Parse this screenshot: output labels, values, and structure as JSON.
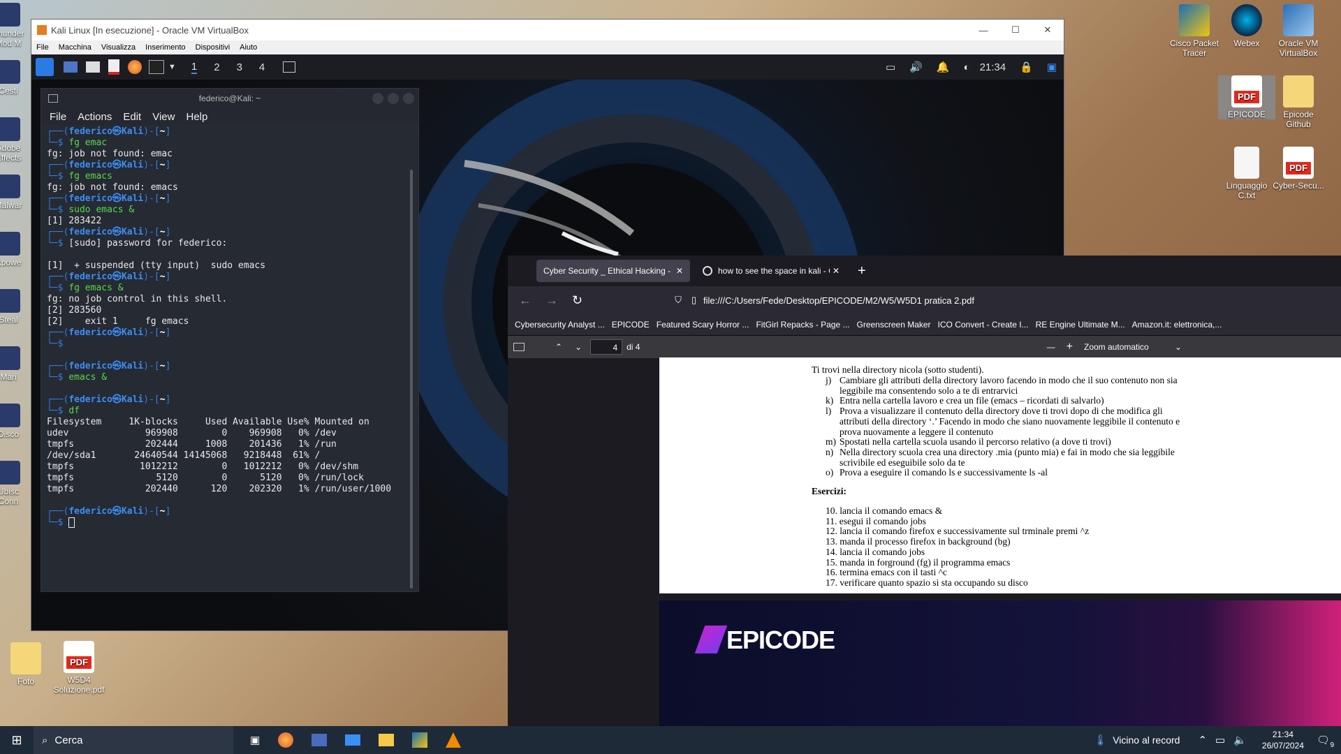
{
  "desktop": {
    "icons_left": [
      "Thunder Mod M",
      "Cesti",
      "Adobe Effects",
      "Malwar",
      "Apowe",
      "Steal",
      "Mari",
      "Disco",
      "Ubisc Conn"
    ],
    "icons_right": [
      {
        "label": "Cisco Packet Tracer"
      },
      {
        "label": "Webex"
      },
      {
        "label": "Oracle VM VirtualBox"
      },
      {
        "label": "EPICODE"
      },
      {
        "label": "Epicode Github"
      },
      {
        "label": "Linguaggio C.txt"
      },
      {
        "label": "Cyber-Secu..."
      }
    ],
    "icons_bottom": [
      {
        "label": "Foto"
      },
      {
        "label": "W5D4 Soluzione.pdf"
      }
    ]
  },
  "vbox": {
    "title": "Kali Linux [In esecuzione] - Oracle VM VirtualBox",
    "menu": [
      "File",
      "Macchina",
      "Visualizza",
      "Inserimento",
      "Dispositivi",
      "Aiuto"
    ],
    "workspaces": [
      "1",
      "2",
      "3",
      "4"
    ],
    "clock": "21:34"
  },
  "terminal": {
    "title": "federico@Kali: ~",
    "menu": [
      "File",
      "Actions",
      "Edit",
      "View",
      "Help"
    ],
    "user": "federico",
    "host": "Kali",
    "cwd": "~",
    "prompt_at": "㉿",
    "blocks": [
      {
        "cmd": "fg emac",
        "out": [
          "fg: job not found: emac"
        ]
      },
      {
        "cmd": "fg emacs",
        "out": [
          "fg: job not found: emacs"
        ]
      },
      {
        "cmd": "sudo emacs &",
        "out": [
          "[1] 283422"
        ]
      },
      {
        "cmd": "[sudo] password for federico:",
        "out": [
          "",
          "[1]  + suspended (tty input)  sudo emacs"
        ]
      },
      {
        "cmd": "fg emacs &",
        "out": [
          "fg: no job control in this shell.",
          "[2] 283560",
          "[2]    exit 1     fg emacs"
        ]
      },
      {
        "cmd": "",
        "out": [
          ""
        ]
      },
      {
        "cmd": "emacs &",
        "out": [
          ""
        ]
      },
      {
        "cmd": "df",
        "out": [
          "Filesystem     1K-blocks     Used Available Use% Mounted on",
          "udev              969908        0    969908   0% /dev",
          "tmpfs             202444     1008    201436   1% /run",
          "/dev/sda1       24640544 14145068   9218448  61% /",
          "tmpfs            1012212        0   1012212   0% /dev/shm",
          "tmpfs               5120        0      5120   0% /run/lock",
          "tmpfs             202440      120    202320   1% /run/user/1000",
          ""
        ]
      },
      {
        "cmd": "",
        "out": []
      }
    ]
  },
  "browser": {
    "tabs": [
      {
        "label": "Cyber Security _ Ethical Hacking - M",
        "active": true
      },
      {
        "label": "how to see the space in kali - C",
        "active": false
      }
    ],
    "url": "file:///C:/Users/Fede/Desktop/EPICODE/M2/W5/W5D1 pratica 2.pdf",
    "bookmarks": [
      "Cybersecurity Analyst ...",
      "EPICODE",
      "Featured Scary Horror ...",
      "FitGirl Repacks - Page ...",
      "Greenscreen Maker",
      "ICO Convert - Create I...",
      "RE Engine Ultimate M...",
      "Amazon.it: elettronica,..."
    ],
    "pdf": {
      "page": "4",
      "of": "di 4",
      "zoom": "Zoom automatico",
      "intro": "Ti trovi nella directory nicola (sotto studenti).",
      "items": [
        {
          "k": "j)",
          "t": "Cambiare gli attributi della directory lavoro facendo in modo che il suo contenuto non sia"
        },
        {
          "k": "",
          "t": "leggibile ma consentendo solo a te di entrarvici"
        },
        {
          "k": "k)",
          "t": "Entra nella cartella lavoro e crea un file (emacs – ricordati di salvarlo)"
        },
        {
          "k": "l)",
          "t": "Prova a visualizzare il contenuto della directory dove ti trovi dopo di che modifica gli"
        },
        {
          "k": "",
          "t": "attributi della directory ‘.’ Facendo in modo che siano nuovamente leggibile il contenuto e"
        },
        {
          "k": "",
          "t": "prova nuovamente a leggere il contenuto"
        },
        {
          "k": "m)",
          "t": "Spostati nella cartella scuola usando il percorso relativo (a dove ti trovi)"
        },
        {
          "k": "n)",
          "t": "Nella directory scuola crea una directory .mia (punto mia) e fai in modo che sia leggibile"
        },
        {
          "k": "",
          "t": "scrivibile ed eseguibile solo da te"
        },
        {
          "k": "o)",
          "t": "Prova a eseguire il comando ls e successivamente ls -al"
        }
      ],
      "exercises_title": "Esercizi:",
      "exercises": [
        "10. lancia il comando emacs &",
        "11. esegui il comando jobs",
        "12. lancia il comando firefox e successivamente sul trminale premi ^z",
        "13. manda il processo firefox in background (bg)",
        "14. lancia il comando jobs",
        "15. manda in forground (fg) il programma emacs",
        "16. termina emacs con il tasti ^c",
        "17. verificare quanto spazio si sta occupando su disco"
      ],
      "banner_logo": "EPICODE"
    }
  },
  "taskbar": {
    "search_placeholder": "Cerca",
    "weather": "Vicino al record",
    "time": "21:34",
    "date": "26/07/2024",
    "notifications": "9"
  }
}
